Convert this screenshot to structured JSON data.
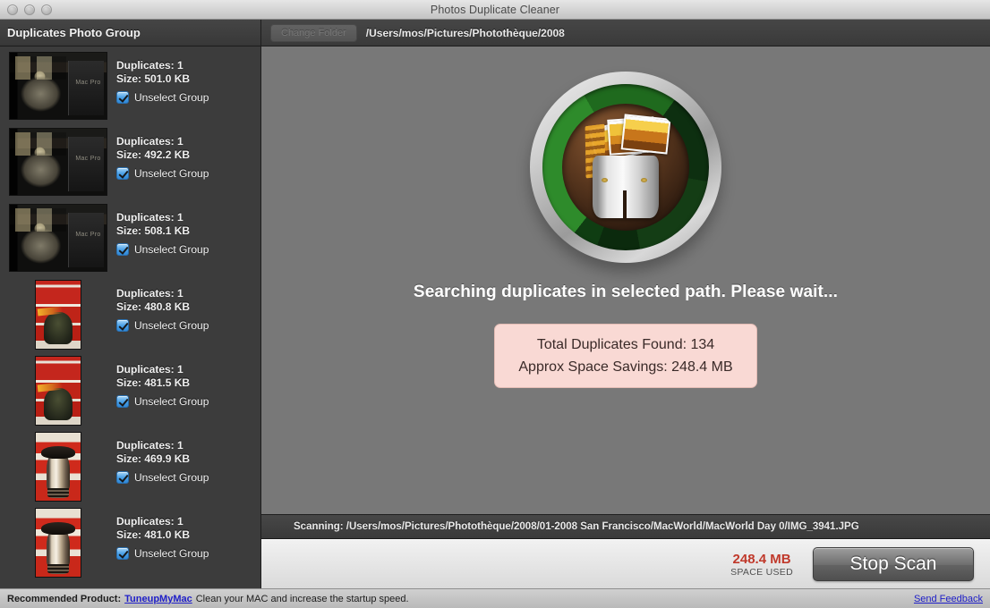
{
  "window": {
    "title": "Photos Duplicate Cleaner",
    "traffic_lights": [
      "close-button",
      "minimize-button",
      "zoom-button"
    ]
  },
  "toolbar": {
    "sidebar_title": "Duplicates Photo Group",
    "change_folder_label": "Change Folder",
    "path": "/Users/mos/Pictures/Photothèque/2008"
  },
  "sidebar": {
    "groups": [
      {
        "duplicates": "Duplicates: 1",
        "size": "Size: 501.0 KB",
        "checkbox_label": "Unselect Group",
        "checked": true,
        "thumb": "macpro-wide"
      },
      {
        "duplicates": "Duplicates: 1",
        "size": "Size: 492.2 KB",
        "checkbox_label": "Unselect Group",
        "checked": true,
        "thumb": "macpro-wide"
      },
      {
        "duplicates": "Duplicates: 1",
        "size": "Size: 508.1 KB",
        "checkbox_label": "Unselect Group",
        "checked": true,
        "thumb": "macpro-wide"
      },
      {
        "duplicates": "Duplicates: 1",
        "size": "Size: 480.8 KB",
        "checkbox_label": "Unselect Group",
        "checked": true,
        "thumb": "statue-tall"
      },
      {
        "duplicates": "Duplicates: 1",
        "size": "Size: 481.5 KB",
        "checkbox_label": "Unselect Group",
        "checked": true,
        "thumb": "statue-tall"
      },
      {
        "duplicates": "Duplicates: 1",
        "size": "Size: 469.9 KB",
        "checkbox_label": "Unselect Group",
        "checked": true,
        "thumb": "bullet-tall"
      },
      {
        "duplicates": "Duplicates: 1",
        "size": "Size: 481.0 KB",
        "checkbox_label": "Unselect Group",
        "checked": true,
        "thumb": "bullet-tall"
      }
    ]
  },
  "main": {
    "logo_name": "app-logo-trash-photos",
    "status_message": "Searching duplicates in selected path. Please wait...",
    "result": {
      "total_duplicates": "Total Duplicates Found: 134",
      "space_savings": "Approx Space Savings: 248.4 MB"
    },
    "scanning": "Scanning: /Users/mos/Pictures/Photothèque/2008/01-2008 San Francisco/MacWorld/MacWorld Day 0/IMG_3941.JPG"
  },
  "action_bar": {
    "space_value": "248.4 MB",
    "space_label": "SPACE USED",
    "stop_button": "Stop Scan"
  },
  "footer": {
    "recommended_label": "Recommended Product:",
    "product_link": "TuneupMyMac",
    "tagline": "Clean your MAC and increase the startup speed.",
    "feedback_link": "Send Feedback"
  },
  "colors": {
    "accent_red": "#c0392b",
    "link_blue": "#2020c8",
    "result_box_bg": "#f9d9d4",
    "logo_green": "#2e8b2b"
  }
}
